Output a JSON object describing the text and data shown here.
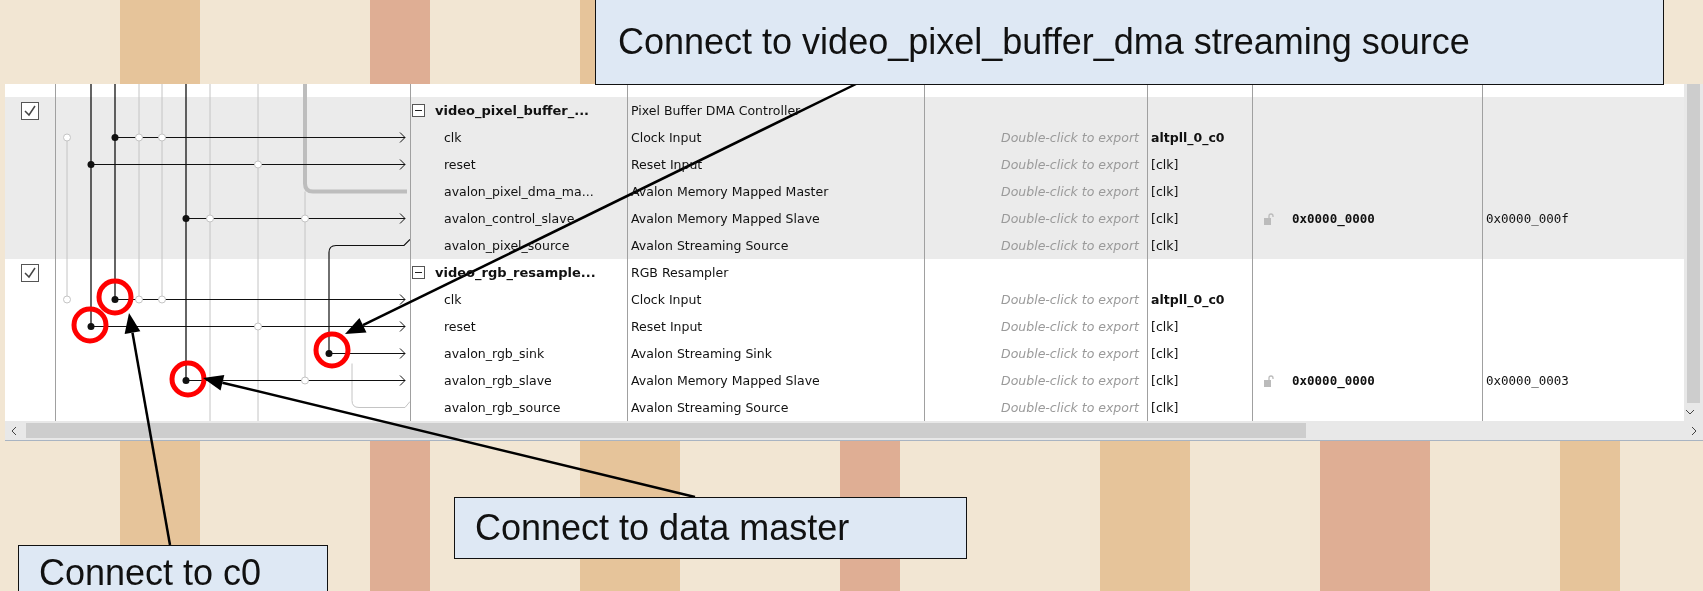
{
  "callouts": [
    {
      "text": "Connect to video_pixel_buffer_dma streaming source"
    },
    {
      "text": "Connect to data master"
    },
    {
      "text": "Connect to c0"
    }
  ],
  "components": [
    {
      "name": "video_pixel_buffer_...",
      "description": "Pixel Buffer DMA Controller",
      "enabled": true,
      "expanded": true,
      "interfaces": [
        {
          "kind": "clock",
          "name": "clk",
          "description": "Clock Input",
          "export": "Double-click to export",
          "clock": "altpll_0_c0"
        },
        {
          "kind": "reset",
          "name": "reset",
          "description": "Reset Input",
          "export": "Double-click to export",
          "clock": "[clk]"
        },
        {
          "kind": "master",
          "name": "avalon_pixel_dma_ma...",
          "description": "Avalon Memory Mapped Master",
          "export": "Double-click to export",
          "clock": "[clk]"
        },
        {
          "kind": "slave",
          "name": "avalon_control_slave",
          "description": "Avalon Memory Mapped Slave",
          "export": "Double-click to export",
          "clock": "[clk]",
          "base": "0x0000_0000",
          "end": "0x0000_000f"
        },
        {
          "kind": "source",
          "name": "avalon_pixel_source",
          "description": "Avalon Streaming Source",
          "export": "Double-click to export",
          "clock": "[clk]"
        }
      ]
    },
    {
      "name": "video_rgb_resample...",
      "description": "RGB Resampler",
      "enabled": true,
      "expanded": true,
      "interfaces": [
        {
          "kind": "clock",
          "name": "clk",
          "description": "Clock Input",
          "export": "Double-click to export",
          "clock": "altpll_0_c0"
        },
        {
          "kind": "reset",
          "name": "reset",
          "description": "Reset Input",
          "export": "Double-click to export",
          "clock": "[clk]"
        },
        {
          "kind": "sink",
          "name": "avalon_rgb_sink",
          "description": "Avalon Streaming Sink",
          "export": "Double-click to export",
          "clock": "[clk]"
        },
        {
          "kind": "slave",
          "name": "avalon_rgb_slave",
          "description": "Avalon Memory Mapped Slave",
          "export": "Double-click to export",
          "clock": "[clk]",
          "base": "0x0000_0000",
          "end": "0x0000_0003"
        },
        {
          "kind": "source",
          "name": "avalon_rgb_source",
          "description": "Avalon Streaming Source",
          "export": "Double-click to export",
          "clock": "[clk]"
        }
      ]
    }
  ]
}
